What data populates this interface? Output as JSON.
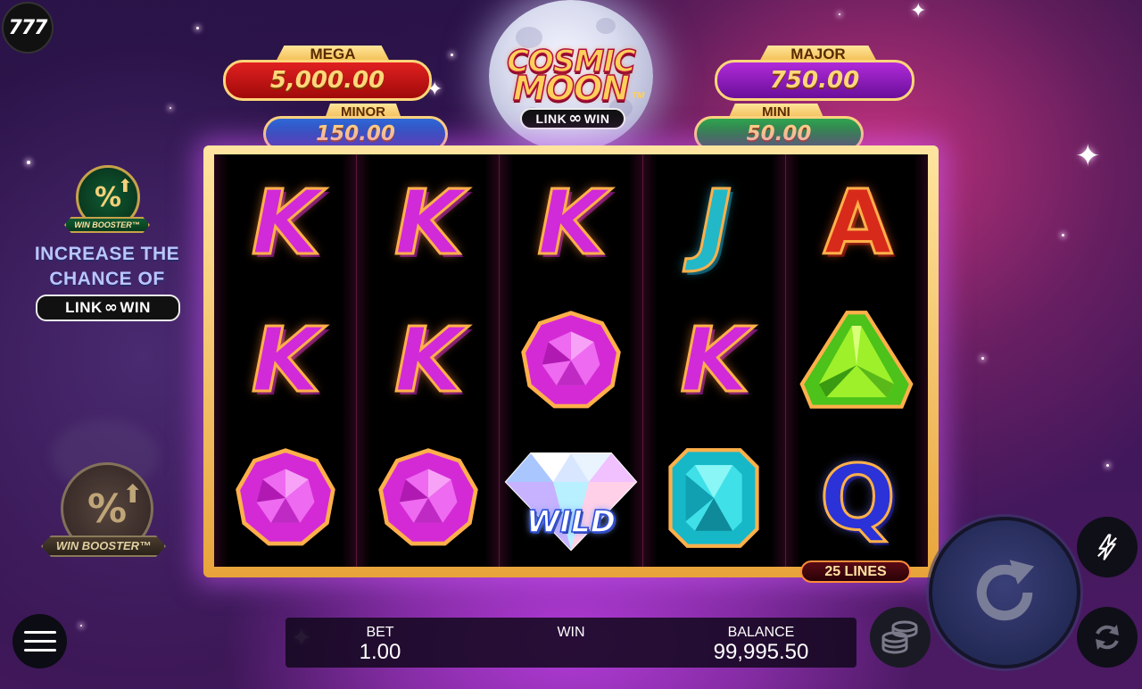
{
  "brand_badge": "777",
  "game": {
    "title_line1": "COSMIC",
    "title_line2": "MOON",
    "trademark": "TM",
    "link_win": {
      "left": "LINK",
      "right": "WIN"
    }
  },
  "jackpots": {
    "mega": {
      "label": "MEGA",
      "value": "5,000.00"
    },
    "major": {
      "label": "MAJOR",
      "value": "750.00"
    },
    "minor": {
      "label": "MINOR",
      "value": "150.00"
    },
    "mini": {
      "label": "MINI",
      "value": "50.00"
    }
  },
  "reels": [
    [
      "K",
      "K",
      "purple-gem"
    ],
    [
      "K",
      "K",
      "purple-gem"
    ],
    [
      "K",
      "purple-gem",
      "WILD"
    ],
    [
      "J",
      "K",
      "teal-gem"
    ],
    [
      "A",
      "green-gem",
      "Q"
    ]
  ],
  "wild_label": "WILD",
  "lines_label": "25 LINES",
  "win_booster": {
    "ribbon": "WIN BOOSTER",
    "tm": "™",
    "promo_line1": "INCREASE THE",
    "promo_line2": "CHANCE OF",
    "symbol": "%"
  },
  "bottom_bar": {
    "bet_label": "BET",
    "bet_value": "1.00",
    "win_label": "WIN",
    "win_value": "",
    "balance_label": "BALANCE",
    "balance_value": "99,995.50"
  },
  "icons": {
    "menu": "hamburger-icon",
    "coins": "coins-icon",
    "spin": "spin-arrow-icon",
    "turbo": "lightning-off-icon",
    "autoplay": "autoplay-icon"
  },
  "colors": {
    "gold": "#ffd67a",
    "mega": "#e02020",
    "major": "#b02ad8",
    "minor": "#2a6ad8",
    "mini": "#2aa84a"
  }
}
